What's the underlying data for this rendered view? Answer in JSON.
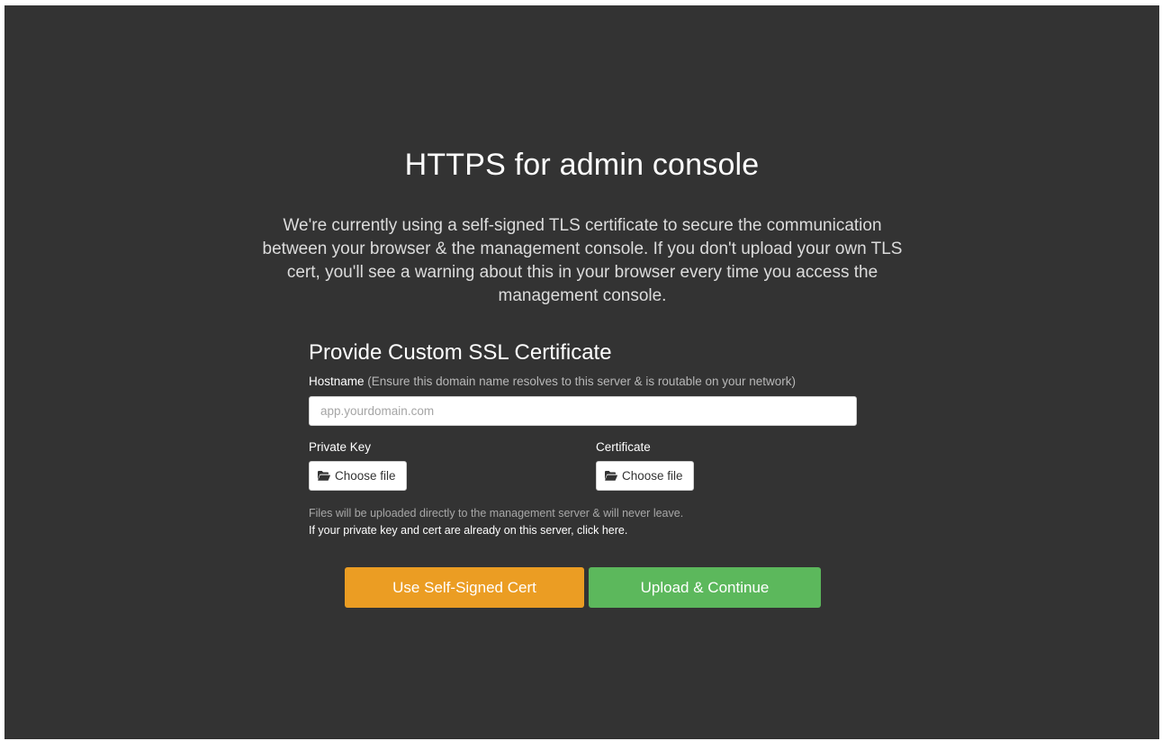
{
  "page": {
    "title": "HTTPS for admin console",
    "intro": "We're currently using a self-signed TLS certificate to secure the communication between your browser & the management console. If you don't upload your own TLS cert, you'll see a warning about this in your browser every time you access the management console."
  },
  "form": {
    "section_title": "Provide Custom SSL Certificate",
    "hostname": {
      "label": "Hostname",
      "hint": "(Ensure this domain name resolves to this server & is routable on your network)",
      "placeholder": "app.yourdomain.com",
      "value": ""
    },
    "private_key": {
      "label": "Private Key",
      "button_label": "Choose file",
      "icon": "folder-open-icon"
    },
    "certificate": {
      "label": "Certificate",
      "button_label": "Choose file",
      "icon": "folder-open-icon"
    },
    "upload_note": "Files will be uploaded directly to the management server & will never leave.",
    "server_files_link": "If your private key and cert are already on this server, click here."
  },
  "actions": {
    "self_signed_label": "Use Self-Signed Cert",
    "upload_label": "Upload & Continue"
  },
  "colors": {
    "background": "#333333",
    "self_signed_button": "#eb9d23",
    "upload_button": "#5cb85c"
  }
}
